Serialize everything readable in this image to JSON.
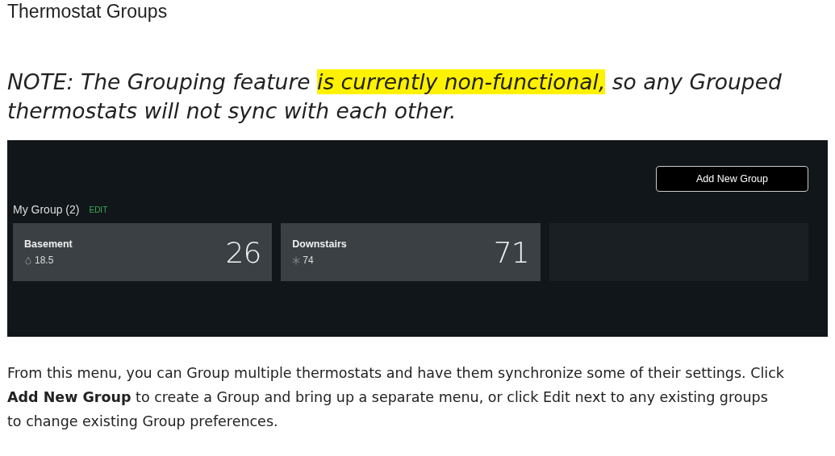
{
  "heading": "Thermostat Groups",
  "note": [
    {
      "text": "NOTE: The Grouping feature ",
      "highlight": false
    },
    {
      "text": "is currently non-functional,",
      "highlight": true
    },
    {
      "text": " so any Grouped thermostats will not sync with each other.",
      "highlight": false
    }
  ],
  "app": {
    "add_button": "Add New Group",
    "group_title": "My Group (2)",
    "edit_link": "EDIT",
    "cards": [
      {
        "kind": "heating",
        "name": "Basement",
        "setpoint": "18.5",
        "temperature": "26"
      },
      {
        "kind": "cooling",
        "name": "Downstairs",
        "setpoint": "74",
        "temperature": "71"
      },
      {
        "kind": "empty"
      }
    ]
  },
  "paragraph": "From this menu, you can Group multiple thermostats and have them synchronize some of their settings. Click **Add New Group** to create a Group and bring up a separate menu, or click Edit next to any existing groups to change existing Group preferences."
}
